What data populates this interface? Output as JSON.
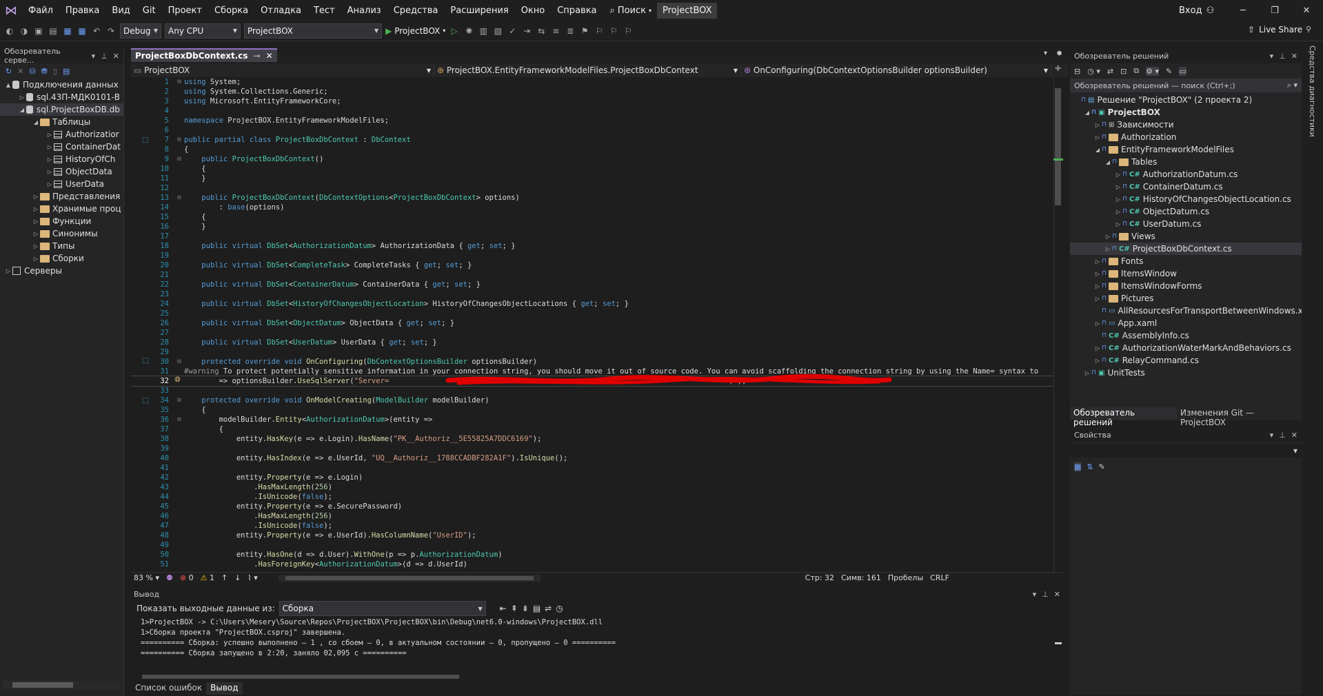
{
  "menubar": {
    "items": [
      "Файл",
      "Правка",
      "Вид",
      "Git",
      "Проект",
      "Сборка",
      "Отладка",
      "Тест",
      "Анализ",
      "Средства",
      "Расширения",
      "Окно",
      "Справка"
    ],
    "search": "Поиск",
    "title": "ProjectBOX",
    "login": "Вход"
  },
  "toolbar": {
    "config": "Debug",
    "platform": "Any CPU",
    "startup": "ProjectBOX",
    "run": "ProjectBOX",
    "liveshare": "Live Share"
  },
  "server_explorer": {
    "title": "Обозреватель серве...",
    "items": [
      "Подключения данных",
      "sql.43П-МДК0101-В",
      "sql.ProjectBoxDB.db",
      "Таблицы",
      "Authorizatior",
      "ContainerDat",
      "HistoryOfCh",
      "ObjectData",
      "UserData",
      "Представления",
      "Хранимые проц",
      "Функции",
      "Синонимы",
      "Типы",
      "Сборки",
      "Серверы"
    ]
  },
  "editor": {
    "tab": "ProjectBoxDbContext.cs",
    "nav": [
      "ProjectBOX",
      "ProjectBOX.EntityFrameworkModelFiles.ProjectBoxDbContext",
      "OnConfiguring(DbContextOptionsBuilder optionsBuilder)"
    ],
    "lines": [
      "using System;",
      "using System.Collections.Generic;",
      "using Microsoft.EntityFrameworkCore;",
      "",
      "namespace ProjectBOX.EntityFrameworkModelFiles;",
      "",
      "public partial class ProjectBoxDbContext : DbContext",
      "{",
      "    public ProjectBoxDbContext()",
      "    {",
      "    }",
      "",
      "    public ProjectBoxDbContext(DbContextOptions<ProjectBoxDbContext> options)",
      "        : base(options)",
      "    {",
      "    }",
      "",
      "    public virtual DbSet<AuthorizationDatum> AuthorizationData { get; set; }",
      "",
      "    public virtual DbSet<CompleteTask> CompleteTasks { get; set; }",
      "",
      "    public virtual DbSet<ContainerDatum> ContainerData { get; set; }",
      "",
      "    public virtual DbSet<HistoryOfChangesObjectLocation> HistoryOfChangesObjectLocations { get; set; }",
      "",
      "    public virtual DbSet<ObjectDatum> ObjectData { get; set; }",
      "",
      "    public virtual DbSet<UserDatum> UserData { get; set; }",
      "",
      "    protected override void OnConfiguring(DbContextOptionsBuilder optionsBuilder)",
      "#warning To protect potentially sensitive information in your connection string, you should move it out of source code. You can avoid scaffolding the connection string by using the Name= syntax to",
      "        => optionsBuilder.UseSqlServer(\"Server=                                                                              ;\");",
      "",
      "    protected override void OnModelCreating(ModelBuilder modelBuilder)",
      "    {",
      "        modelBuilder.Entity<AuthorizationDatum>(entity =>",
      "        {",
      "            entity.HasKey(e => e.Login).HasName(\"PK__Authoriz__5E55825A7DDC6169\");",
      "",
      "            entity.HasIndex(e => e.UserId, \"UQ__Authoriz__1788CCADBF282A1F\").IsUnique();",
      "",
      "            entity.Property(e => e.Login)",
      "                .HasMaxLength(256)",
      "                .IsUnicode(false);",
      "            entity.Property(e => e.SecurePassword)",
      "                .HasMaxLength(256)",
      "                .IsUnicode(false);",
      "            entity.Property(e => e.UserId).HasColumnName(\"UserID\");",
      "",
      "            entity.HasOne(d => d.User).WithOne(p => p.AuthorizationDatum)",
      "                .HasForeignKey<AuthorizationDatum>(d => d.UserId)"
    ]
  },
  "editor_status": {
    "zoom": "83 %",
    "errors": "0",
    "warnings": "1",
    "line": "Стр: 32",
    "col": "Симв: 161",
    "spaces": "Пробелы",
    "eol": "CRLF"
  },
  "output": {
    "title": "Вывод",
    "show_label": "Показать выходные данные из:",
    "source": "Сборка",
    "lines": [
      "1>ProjectBOX -> C:\\Users\\Mesery\\Source\\Repos\\ProjectBOX\\ProjectBOX\\bin\\Debug\\net6.0-windows\\ProjectBOX.dll",
      "1>Сборка проекта \"ProjectBOX.csproj\" завершена.",
      "========== Сборка: успешно выполнено — 1 , со сбоем — 0, в актуальном состоянии — 0, пропущено — 0 ==========",
      "========== Сборка запущено в 2:20, заняло 02,095 с =========="
    ],
    "tabs": [
      "Список ошибок",
      "Вывод"
    ]
  },
  "solution": {
    "title": "Обозреватель решений",
    "search": "Обозреватель решений — поиск (Ctrl+;)",
    "items": [
      "Решение \"ProjectBOX\"  (2 проекта 2)",
      "ProjectBOX",
      "Зависимости",
      "Authorization",
      "EntityFrameworkModelFiles",
      "Tables",
      "AuthorizationDatum.cs",
      "ContainerDatum.cs",
      "HistoryOfChangesObjectLocation.cs",
      "ObjectDatum.cs",
      "UserDatum.cs",
      "Views",
      "ProjectBoxDbContext.cs",
      "Fonts",
      "ItemsWindow",
      "ItemsWindowForms",
      "Pictures",
      "AllResourcesForTransportBetweenWindows.xaml",
      "App.xaml",
      "AssemblyInfo.cs",
      "AuthorizationWaterMarkAndBehaviors.cs",
      "RelayCommand.cs",
      "UnitTests"
    ],
    "tabs": [
      "Обозреватель решений",
      "Изменения Git — ProjectBOX"
    ]
  },
  "properties": {
    "title": "Свойства"
  },
  "right_sidebar": {
    "label": "Средства диагностики"
  },
  "colors": {
    "accent": "#9070c0",
    "keyword": "#569cd6",
    "type": "#4ec9b0",
    "string": "#d69d85",
    "redaction": "#e00000"
  }
}
